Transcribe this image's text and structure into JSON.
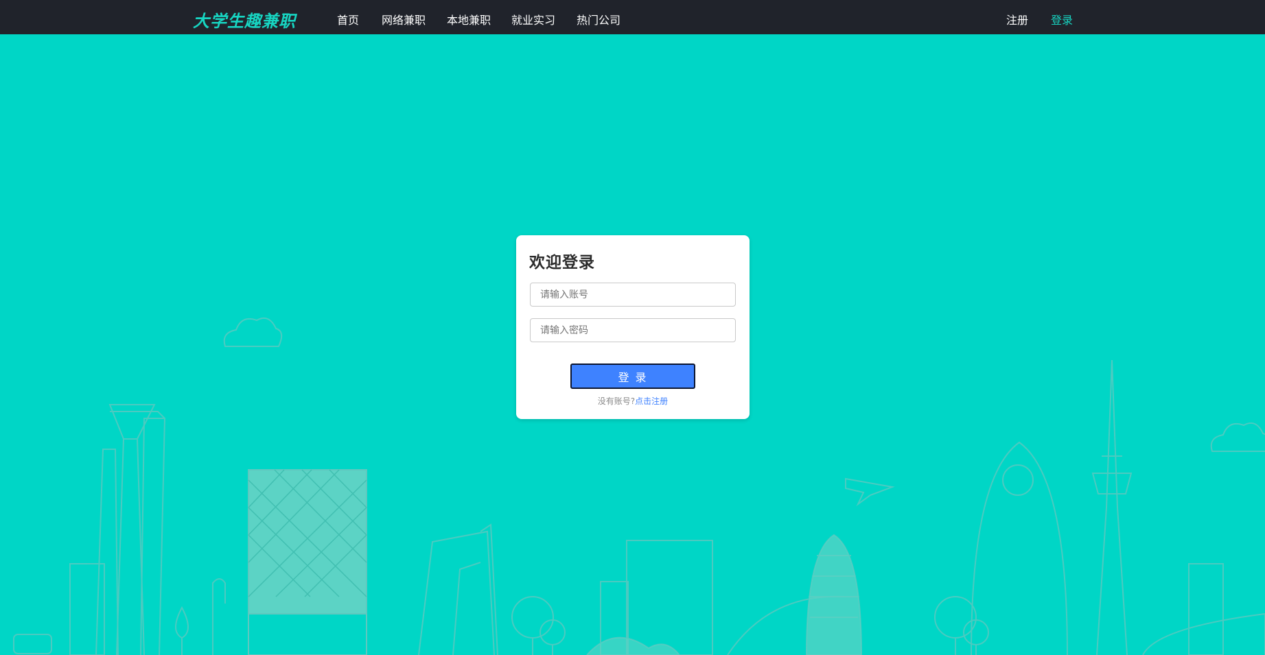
{
  "header": {
    "logo": "大学生趣兼职",
    "nav": [
      "首页",
      "网络兼职",
      "本地兼职",
      "就业实习",
      "热门公司"
    ],
    "register": "注册",
    "login": "登录"
  },
  "login_card": {
    "title": "欢迎登录",
    "account_placeholder": "请输入账号",
    "password_placeholder": "请输入密码",
    "submit_label": "登 录",
    "no_account_text": "没有账号?",
    "register_link": "点击注册"
  },
  "colors": {
    "background": "#00d6c6",
    "header_bg": "#20232b",
    "accent": "#17d5c2",
    "button": "#3e82ff"
  }
}
